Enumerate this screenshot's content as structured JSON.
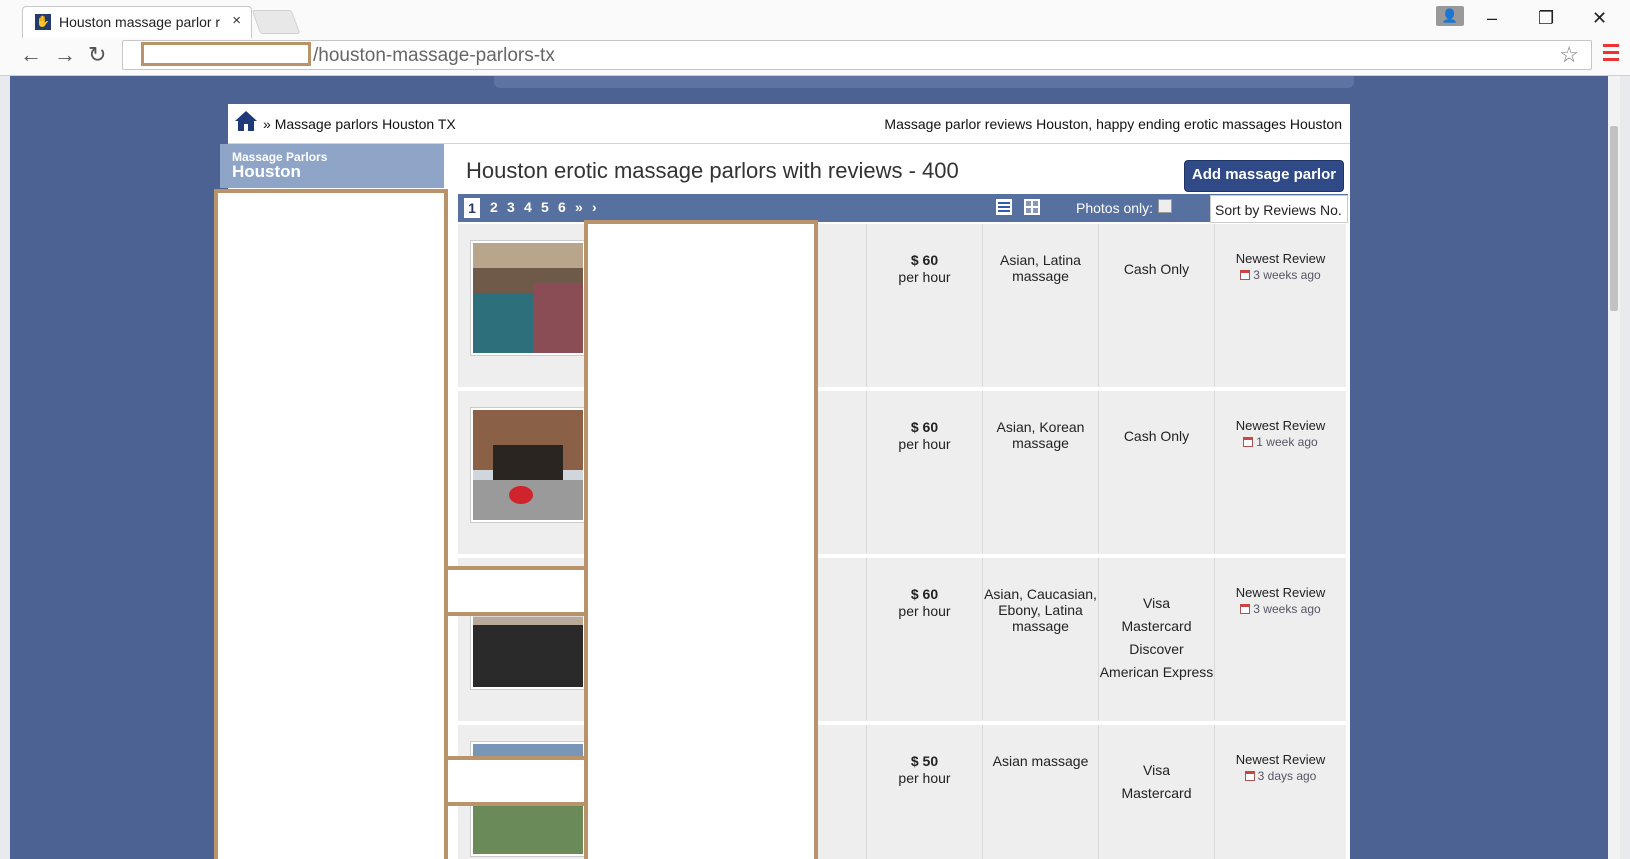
{
  "browser": {
    "tab_title": "Houston massage parlor r",
    "tab_close": "×",
    "url_path": "/houston-massage-parlors-tx"
  },
  "breadcrumb": {
    "separator": "»",
    "current": "Massage parlors Houston TX",
    "right_text": "Massage parlor reviews Houston, happy ending erotic massages Houston"
  },
  "sidebar": {
    "heading_small": "Massage Parlors",
    "heading_city": "Houston"
  },
  "content": {
    "title": "Houston erotic massage parlors with reviews - 400",
    "add_button": "Add massage parlor",
    "pages": [
      "1",
      "2",
      "3",
      "4",
      "5",
      "6",
      "»",
      "›"
    ],
    "photos_only": "Photos only:",
    "sort_label": "Sort by Reviews No."
  },
  "listings": [
    {
      "price": "$ 60",
      "per": "per hour",
      "service": [
        "Asian, Latina",
        "massage"
      ],
      "payment": [
        "Cash Only"
      ],
      "newest_label": "Newest Review",
      "newest_ago": "3 weeks ago"
    },
    {
      "price": "$ 60",
      "per": "per hour",
      "service": [
        "Asian, Korean",
        "massage"
      ],
      "payment": [
        "Cash Only"
      ],
      "newest_label": "Newest Review",
      "newest_ago": "1 week ago"
    },
    {
      "price": "$ 60",
      "per": "per hour",
      "service": [
        "Asian, Caucasian,",
        "Ebony, Latina",
        "massage"
      ],
      "payment": [
        "Visa",
        "Mastercard",
        "Discover",
        "American Express"
      ],
      "newest_label": "Newest Review",
      "newest_ago": "3 weeks ago"
    },
    {
      "price": "$ 50",
      "per": "per hour",
      "service": [
        "Asian massage"
      ],
      "payment": [
        "Visa",
        "Mastercard"
      ],
      "newest_label": "Newest Review",
      "newest_ago": "3 days ago"
    }
  ],
  "colors": {
    "page_background": "#4b6292",
    "pager_bar": "#56709f",
    "add_button": "#2f4a86",
    "redaction_border": "#b9946b"
  }
}
